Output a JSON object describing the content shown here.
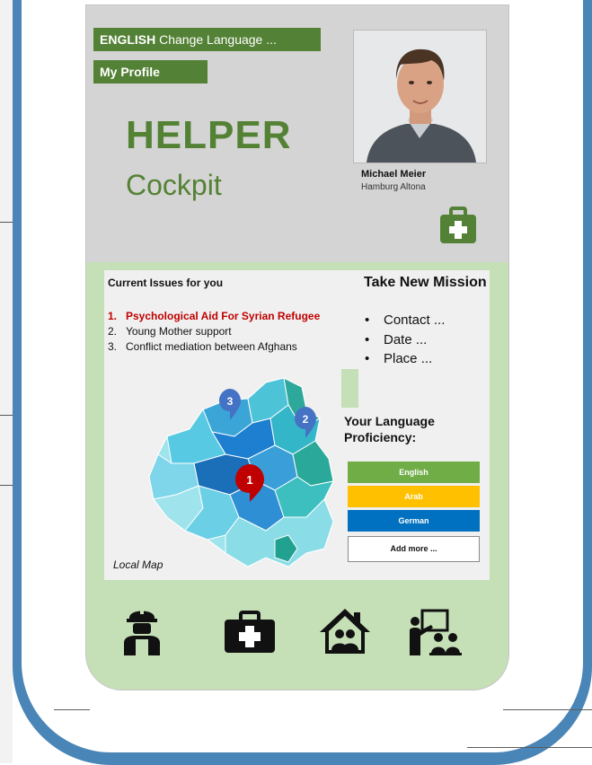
{
  "header": {
    "language_code": "ENGLISH",
    "language_action": "Change Language ...",
    "profile_label": "My Profile"
  },
  "title": {
    "main": "HELPER",
    "sub": "Cockpit"
  },
  "user": {
    "name": "Michael Meier",
    "location": "Hamburg Altona"
  },
  "issues": {
    "title": "Current Issues for you",
    "items": [
      {
        "num": "1.",
        "label": "Psychological Aid For Syrian Refugee"
      },
      {
        "num": "2.",
        "label": "Young Mother support"
      },
      {
        "num": "3.",
        "label": "Conflict mediation between Afghans"
      }
    ]
  },
  "mission": {
    "title": "Take New Mission",
    "items": [
      "Contact ...",
      "Date ...",
      "Place ..."
    ]
  },
  "language_proficiency": {
    "title_line1": "Your Language",
    "title_line2": "Proficiency:",
    "languages": [
      {
        "label": "English",
        "color": "#70ad47"
      },
      {
        "label": "Arab",
        "color": "#ffc000"
      },
      {
        "label": "German",
        "color": "#0070c0"
      }
    ],
    "add_label": "Add more ..."
  },
  "map": {
    "label": "Local Map",
    "markers": [
      {
        "num": "1",
        "color": "#c00000"
      },
      {
        "num": "2",
        "color": "#4472c4"
      },
      {
        "num": "3",
        "color": "#4472c4"
      }
    ]
  },
  "nav": {
    "icons": [
      "worker-icon",
      "medical-kit-icon",
      "home-family-icon",
      "teacher-icon"
    ]
  },
  "colors": {
    "accent_green": "#548235",
    "frame_blue": "#4a85b7",
    "phone_gray": "#d4d4d4",
    "phone_green": "#c5dfb7"
  }
}
